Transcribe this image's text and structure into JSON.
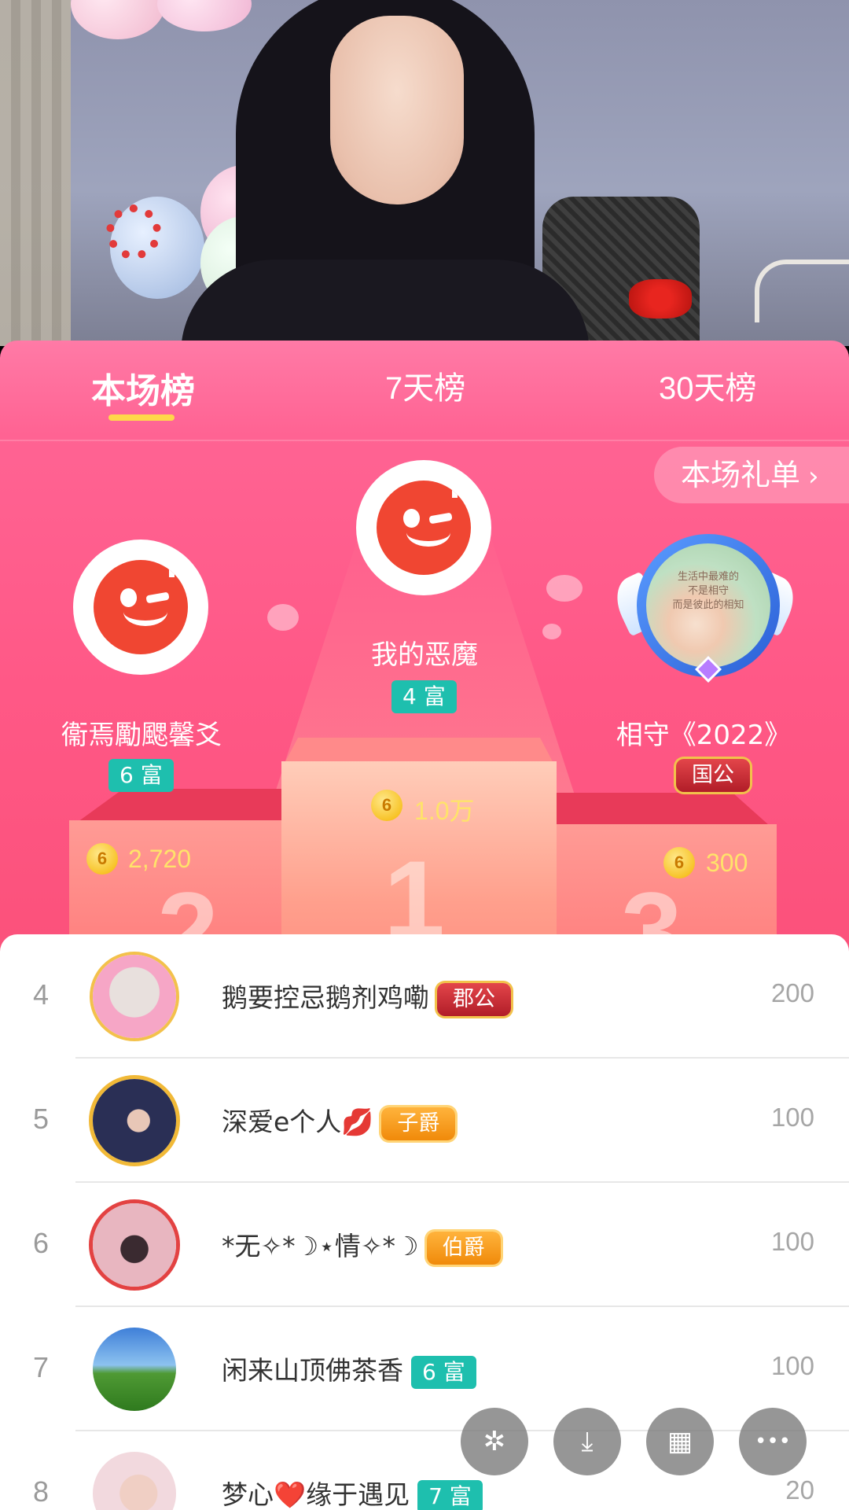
{
  "tabs": [
    {
      "label": "本场榜",
      "active": true
    },
    {
      "label": "7天榜",
      "active": false
    },
    {
      "label": "30天榜",
      "active": false
    }
  ],
  "gift_list_button": {
    "label": "本场礼单",
    "chevron": "›"
  },
  "top3": {
    "first": {
      "name": "我的恶魔",
      "badge": "4 富",
      "coin_symbol": "6",
      "score": "1.0万",
      "podium_number": "1"
    },
    "second": {
      "name": "衞焉勵颸馨爻",
      "badge": "6 富",
      "coin_symbol": "6",
      "score": "2,720",
      "podium_number": "2"
    },
    "third": {
      "name": "相守《2022》",
      "badge": "国公",
      "coin_symbol": "6",
      "score": "300",
      "podium_number": "3",
      "avatar_text": [
        "生活中最难的",
        "不是相守",
        "而是彼此的相知"
      ]
    }
  },
  "list": [
    {
      "rank": "4",
      "name": "鹅要控忌鹅剂鸡嘞",
      "badge": "郡公",
      "badge_type": "noble-red",
      "score": "200"
    },
    {
      "rank": "5",
      "name": "深爱e个人💋",
      "badge": "子爵",
      "badge_type": "noble-orange",
      "score": "100"
    },
    {
      "rank": "6",
      "name": "*无✧*☽⋆情✧*☽",
      "badge": "伯爵",
      "badge_type": "noble-orange",
      "score": "100"
    },
    {
      "rank": "7",
      "name": "闲来山顶佛茶香",
      "badge": "6 富",
      "badge_type": "rich",
      "score": "100"
    },
    {
      "rank": "8",
      "name": "梦心❤️缘于遇见",
      "badge": "7 富",
      "badge_type": "rich",
      "score": "20"
    }
  ],
  "fabs": [
    {
      "icon": "sparkle-icon",
      "glyph": "✲"
    },
    {
      "icon": "download-icon",
      "glyph": "⤓"
    },
    {
      "icon": "grid-icon",
      "glyph": "▦"
    },
    {
      "icon": "more-icon",
      "glyph": "•••"
    }
  ],
  "colors": {
    "accent": "#ff5886",
    "tab_indicator": "#ffd84a",
    "rich_badge": "#1ebfae",
    "score": "#ffe36a"
  }
}
